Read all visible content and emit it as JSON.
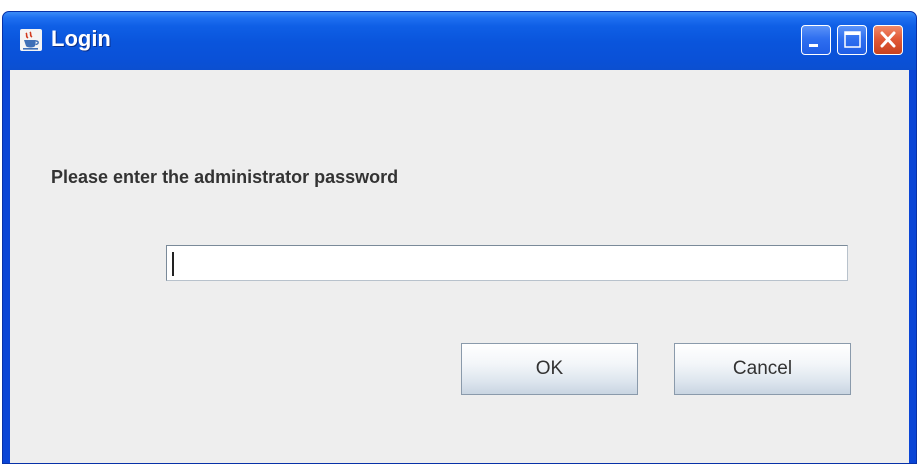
{
  "page_heading": {
    "dark_text": "",
    "red_text": ""
  },
  "window": {
    "title": "Login",
    "icon": "java-cup-icon",
    "controls": {
      "minimize_icon": "minimize-icon",
      "maximize_icon": "maximize-icon",
      "close_icon": "close-icon"
    },
    "colors": {
      "titlebar": "#0a55dc",
      "client_background": "#eeeeee",
      "close_button": "#e25a37"
    }
  },
  "dialog": {
    "prompt": "Please enter the administrator password",
    "password_field": {
      "value": "",
      "placeholder": ""
    },
    "ok_label": "OK",
    "cancel_label": "Cancel"
  }
}
